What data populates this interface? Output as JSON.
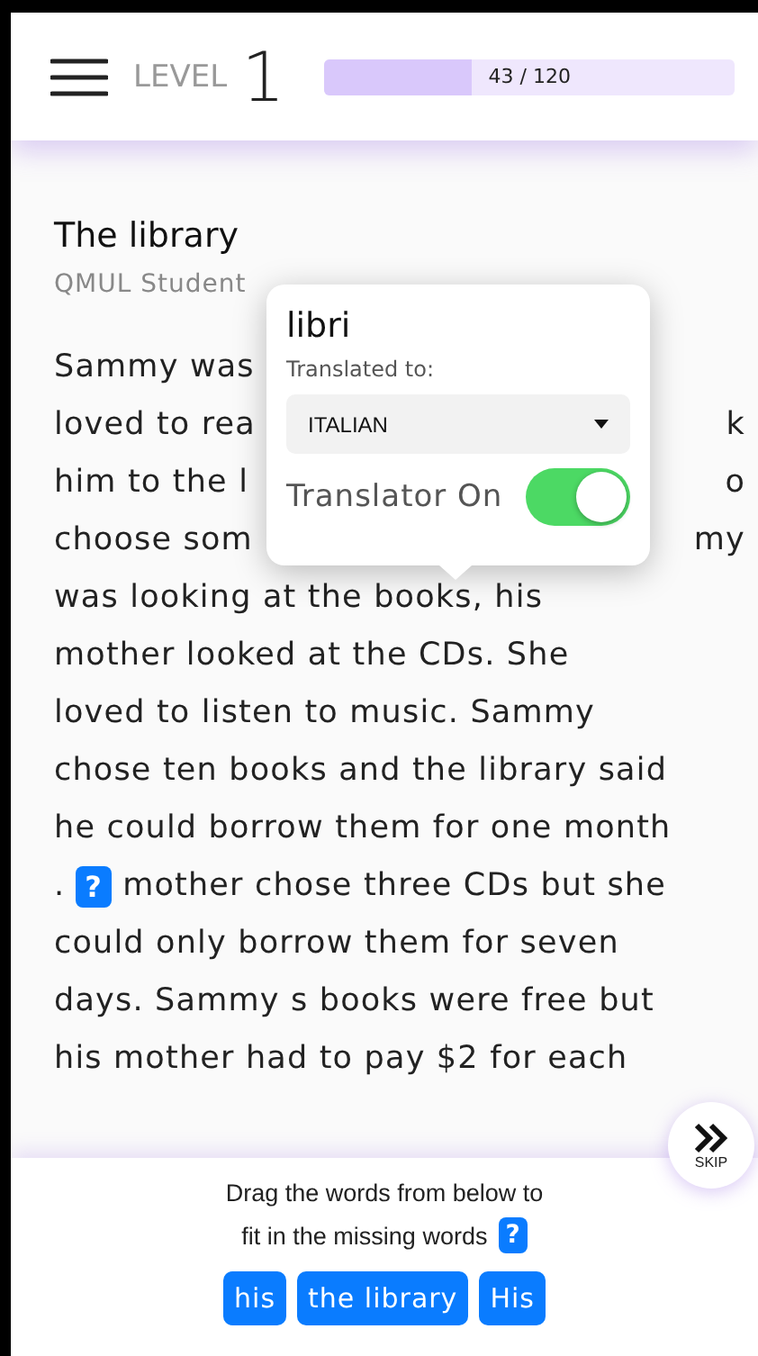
{
  "header": {
    "level_label": "LEVEL",
    "level": "1",
    "progress": {
      "text": "43 / 120",
      "level": 0.358
    }
  },
  "story": {
    "title": "The library",
    "subtitle": "QMUL Student",
    "lines": [
      {
        "kind": "split",
        "left": "Sammy was"
      },
      {
        "kind": "split",
        "left": "loved to rea",
        "right": "k"
      },
      {
        "kind": "split",
        "left": "him to the l",
        "right": "o"
      },
      {
        "kind": "split",
        "left": "choose som",
        "right": "my"
      },
      {
        "kind": "text",
        "left": "was looking at the books, his"
      },
      {
        "kind": "text",
        "left": "mother looked at the CDs. She"
      },
      {
        "kind": "text",
        "left": "loved to listen to music. Sammy"
      },
      {
        "kind": "text",
        "left": "chose ten books and the library said"
      },
      {
        "kind": "text",
        "left": "he could borrow them for one month"
      },
      {
        "kind": "blank",
        "left": ".",
        "blank": "?",
        "right": "mother chose three CDs but she"
      },
      {
        "kind": "text",
        "left": "could only borrow them for seven"
      },
      {
        "kind": "text",
        "left": "days. Sammy s books were free but"
      },
      {
        "kind": "text",
        "left": "his mother had to pay $2 for each"
      }
    ]
  },
  "popup": {
    "word": "libri",
    "label": "Translated to:",
    "language": "ITALIAN",
    "toggle_label": "Translator On",
    "on": true
  },
  "skip": {
    "label": "SKIP"
  },
  "instructions": {
    "line1": "Drag the words from below to",
    "line2": "fit in the missing words",
    "blank": "?"
  },
  "words": [
    "his",
    "the library",
    "His"
  ]
}
